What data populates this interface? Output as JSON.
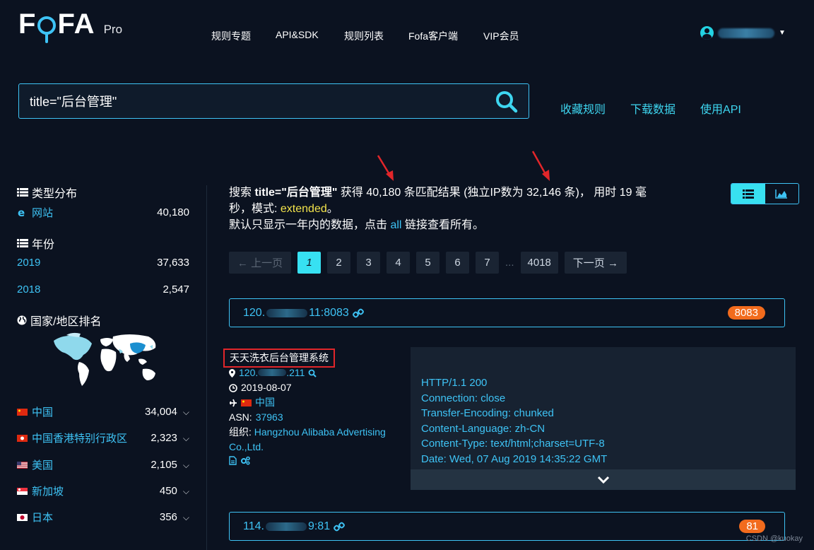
{
  "header": {
    "logo": "FOFA",
    "logo_suffix": "Pro",
    "nav": [
      "规则专题",
      "API&SDK",
      "规则列表",
      "Fofa客户端",
      "VIP会员"
    ]
  },
  "search": {
    "query": "title=\"后台管理\"",
    "links": [
      "收藏规则",
      "下载数据",
      "使用API"
    ]
  },
  "sidebar": {
    "type_title": "类型分布",
    "types": [
      {
        "label": "网站",
        "count": "40,180"
      }
    ],
    "year_title": "年份",
    "years": [
      {
        "label": "2019",
        "count": "37,633"
      },
      {
        "label": "2018",
        "count": "2,547"
      }
    ],
    "country_title": "国家/地区排名",
    "countries": [
      {
        "label": "中国",
        "count": "34,004",
        "flag": "cn"
      },
      {
        "label": "中国香港特别行政区",
        "count": "2,323",
        "flag": "hk"
      },
      {
        "label": "美国",
        "count": "2,105",
        "flag": "us"
      },
      {
        "label": "新加坡",
        "count": "450",
        "flag": "sg"
      },
      {
        "label": "日本",
        "count": "356",
        "flag": "jp"
      }
    ]
  },
  "summary": {
    "prefix": "搜索",
    "query": "title=\"后台管理\"",
    "got": "获得",
    "count": "40,180",
    "result_text": "条匹配结果 (独立IP数为",
    "ip_count": "32,146",
    "ip_suffix": "条)， 用时",
    "time": "19",
    "time_unit": "毫秒，模式:",
    "mode": "extended",
    "period": "。",
    "note_prefix": "默认只显示一年内的数据，点击",
    "note_link": "all",
    "note_suffix": "链接查看所有。"
  },
  "pagination": {
    "prev": "← 上一页",
    "pages": [
      "1",
      "2",
      "3",
      "4",
      "5",
      "6",
      "7"
    ],
    "dots": "...",
    "last": "4018",
    "next": "下一页 →",
    "current": "1"
  },
  "results": [
    {
      "host_prefix": "120.",
      "host_suffix": "11:8083",
      "port": "8083",
      "title": "天天洗衣后台管理系统",
      "ip_prefix": "120.",
      "ip_suffix": ".211",
      "date": "2019-08-07",
      "country": "中国",
      "asn_label": "ASN:",
      "asn": "37963",
      "org_label": "组织:",
      "org": "Hangzhou Alibaba Advertising Co.,Ltd.",
      "banner": "HTTP/1.1 200\nConnection: close\nTransfer-Encoding: chunked\nContent-Language: zh-CN\nContent-Type: text/html;charset=UTF-8\nDate: Wed, 07 Aug 2019 14:35:22 GMT"
    },
    {
      "host_prefix": "114.",
      "host_suffix": "9:81",
      "port": "81"
    }
  ],
  "watermark": "CSDN @kuokay",
  "colors": {
    "background": "#0b1220",
    "accent": "#3ec3f5",
    "active_page": "#37e1f2",
    "port_badge": "#f26b1d",
    "mode_highlight": "#f2e34b",
    "annotation": "#e2262a"
  }
}
